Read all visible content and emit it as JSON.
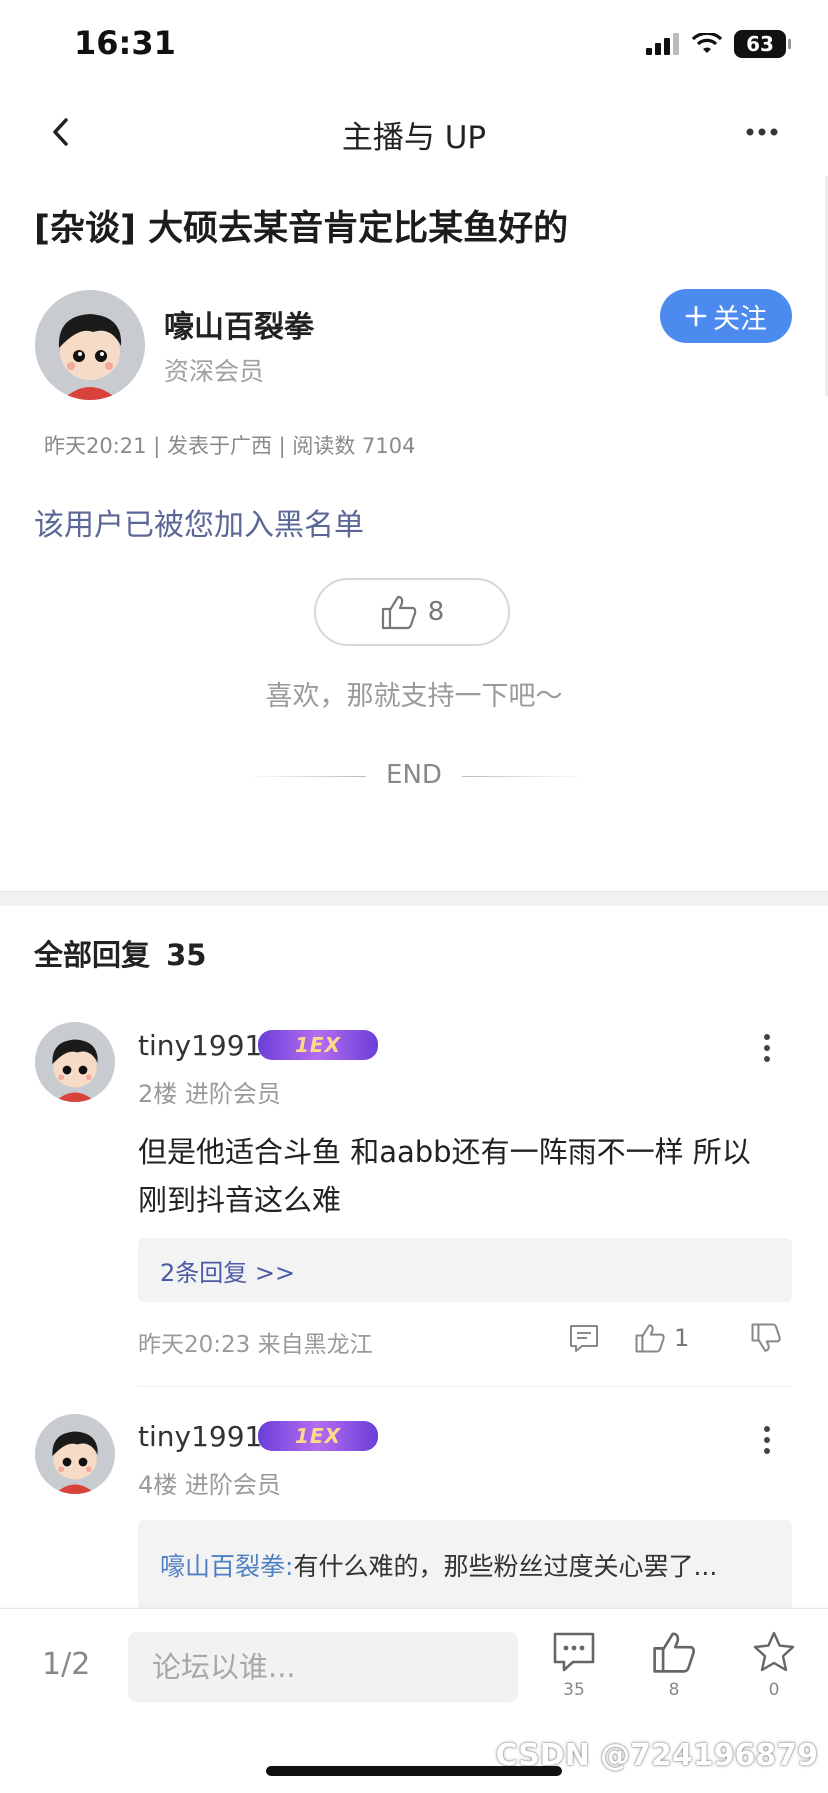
{
  "status_bar": {
    "time": "16:31",
    "battery": "63"
  },
  "nav": {
    "title": "主播与 UP"
  },
  "post": {
    "title": "[杂谈] 大硕去某音肯定比某鱼好的",
    "author": {
      "name": "嚎山百裂拳",
      "level": "资深会员"
    },
    "follow_label": "关注",
    "meta": "昨天20:21 | 发表于广西 | 阅读数 7104",
    "blocked_notice": "该用户已被您加入黑名单",
    "like_count": "8",
    "support_text": "喜欢，那就支持一下吧～",
    "end_label": "END"
  },
  "replies": {
    "header_label": "全部回复",
    "total": "35",
    "items": [
      {
        "username": "tiny1991",
        "badge": "1EX",
        "floor_level": "2楼 进阶会员",
        "body_line1": "但是他适合斗鱼 和aabb还有一阵雨不一样  所以",
        "body_line2": "刚到抖音这么难",
        "sub_replies_label": "2条回复 >>",
        "time_location": "昨天20:23 来自黑龙江",
        "like_count": "1"
      },
      {
        "username": "tiny1991",
        "badge": "1EX",
        "floor_level": "4楼 进阶会员",
        "quote_author": "嚎山百裂拳:",
        "quote_text": " 有什么难的，那些粉丝过度关心罢了..."
      }
    ]
  },
  "bottom_bar": {
    "page_indicator": "1/2",
    "input_placeholder": "论坛以谁...",
    "comment_count": "35",
    "like_count": "8",
    "favorite_count": "0"
  },
  "watermark": "CSDN @724196879",
  "colors": {
    "accent": "#4d8af0",
    "link": "#5b6796",
    "reply_name": "#4f7fc4"
  },
  "icons": [
    "back-icon",
    "more-icon",
    "plus-icon",
    "thumbs-up-icon",
    "thumbs-down-icon",
    "comment-icon",
    "star-icon",
    "signal-icon",
    "wifi-icon",
    "battery-icon"
  ]
}
